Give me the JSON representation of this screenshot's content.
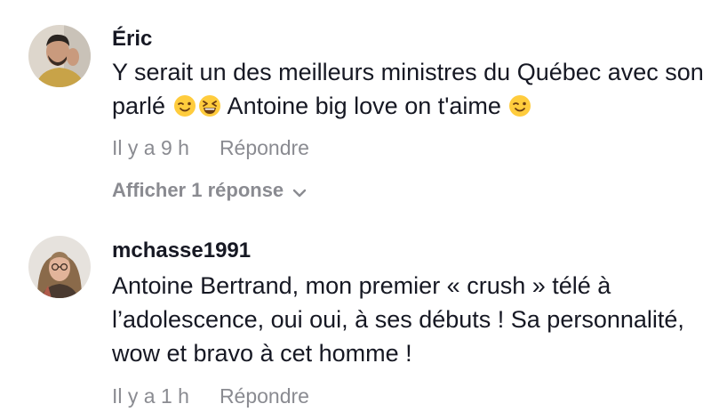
{
  "comments": [
    {
      "username": "Éric",
      "text_part1": "Y serait un des meilleurs ministres du Québec avec son parlé ",
      "text_part2": " Antoine big love on t'aime ",
      "emojis": [
        "winking-face-emoji",
        "grinning-squinting-face-emoji",
        "winking-face-emoji"
      ],
      "time": "Il y a 9 h",
      "reply_label": "Répondre",
      "view_replies_label": "Afficher 1 réponse"
    },
    {
      "username": "mchasse1991",
      "text": "Antoine Bertrand, mon premier « crush » télé à l’adolescence, oui oui, à ses débuts ! Sa personnalité, wow et bravo à cet homme !",
      "time": "Il y a 1 h",
      "reply_label": "Répondre"
    }
  ]
}
